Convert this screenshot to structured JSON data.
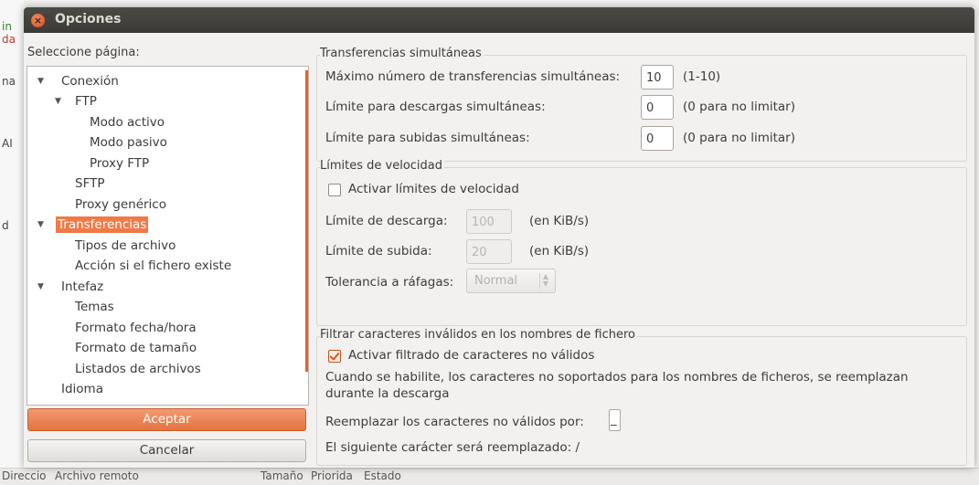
{
  "window": {
    "title": "Opciones"
  },
  "page_select": {
    "label": "Seleccione página:",
    "tree": [
      {
        "label": "Conexión",
        "expanded": true,
        "level": 0
      },
      {
        "label": "FTP",
        "expanded": true,
        "level": 1
      },
      {
        "label": "Modo activo",
        "level": 2
      },
      {
        "label": "Modo pasivo",
        "level": 2
      },
      {
        "label": "Proxy FTP",
        "level": 2
      },
      {
        "label": "SFTP",
        "level": 1
      },
      {
        "label": "Proxy genérico",
        "level": 1
      },
      {
        "label": "Transferencias",
        "expanded": true,
        "level": 0,
        "selected": true
      },
      {
        "label": "Tipos de archivo",
        "level": 1
      },
      {
        "label": "Acción si el fichero existe",
        "level": 1
      },
      {
        "label": "Intefaz",
        "expanded": true,
        "level": 0
      },
      {
        "label": "Temas",
        "level": 1
      },
      {
        "label": "Formato fecha/hora",
        "level": 1
      },
      {
        "label": "Formato de tamaño",
        "level": 1
      },
      {
        "label": "Listados de archivos",
        "level": 1
      },
      {
        "label": "Idioma",
        "level": 0
      }
    ]
  },
  "buttons": {
    "ok": "Aceptar",
    "cancel": "Cancelar"
  },
  "simultaneous": {
    "title": "Transferencias simultáneas",
    "max_label": "Máximo número de transferencias simultáneas:",
    "max_value": "10",
    "max_hint": "(1-10)",
    "downloads_label": "Límite para descargas simultáneas:",
    "downloads_value": "0",
    "downloads_hint": "(0 para no limitar)",
    "uploads_label": "Límite para subidas simultáneas:",
    "uploads_value": "0",
    "uploads_hint": "(0 para no limitar)"
  },
  "speed": {
    "title": "Límites de velocidad",
    "enable_label": "Activar límites de velocidad",
    "enable_checked": false,
    "download_label": "Límite de descarga:",
    "download_value": "100",
    "download_unit": "(en KiB/s)",
    "upload_label": "Límite de subida:",
    "upload_value": "20",
    "upload_unit": "(en KiB/s)",
    "burst_label": "Tolerancia a ráfagas:",
    "burst_value": "Normal"
  },
  "filter": {
    "title": "Filtrar caracteres inválidos en los nombres de fichero",
    "enable_label": "Activar filtrado de caracteres no válidos",
    "enable_checked": true,
    "desc_line1": "Cuando se habilite, los caracteres no soportados para los nombres de ficheros, se reemplazan",
    "desc_line2": "durante la descarga",
    "replace_label": "Reemplazar los caracteres no válidos por:",
    "replace_value": "_",
    "next_char_label": "El siguiente carácter será reemplazado: /"
  },
  "background": {
    "left_fragments": [
      "in",
      "da",
      "na",
      "AI",
      "d"
    ],
    "bottom_columns": [
      "Direccio",
      "Archivo remoto",
      "Tamaño",
      "Priorida",
      "Estado"
    ]
  },
  "colors": {
    "accent": "#e8632a",
    "titlebar": "#3c3b37"
  }
}
